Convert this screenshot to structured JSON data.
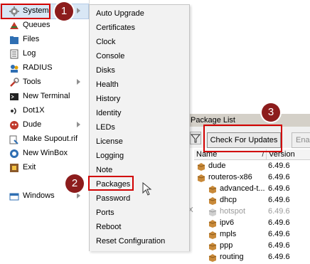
{
  "main_menu": {
    "items": [
      {
        "label": "System",
        "icon": "gear-icon",
        "has_submenu": true
      },
      {
        "label": "Queues",
        "icon": "queues-icon",
        "has_submenu": false
      },
      {
        "label": "Files",
        "icon": "folder-icon",
        "has_submenu": false
      },
      {
        "label": "Log",
        "icon": "log-icon",
        "has_submenu": false
      },
      {
        "label": "RADIUS",
        "icon": "radius-icon",
        "has_submenu": false
      },
      {
        "label": "Tools",
        "icon": "tools-icon",
        "has_submenu": true
      },
      {
        "label": "New Terminal",
        "icon": "terminal-icon",
        "has_submenu": false
      },
      {
        "label": "Dot1X",
        "icon": "dot1x-icon",
        "has_submenu": false
      },
      {
        "label": "Dude",
        "icon": "dude-icon",
        "has_submenu": true
      },
      {
        "label": "Make Supout.rif",
        "icon": "supout-icon",
        "has_submenu": false
      },
      {
        "label": "New WinBox",
        "icon": "winbox-icon",
        "has_submenu": false
      },
      {
        "label": "Exit",
        "icon": "exit-icon",
        "has_submenu": false
      },
      {
        "label": "Windows",
        "icon": "windows-icon",
        "has_submenu": true
      }
    ]
  },
  "submenu": {
    "items": [
      "Auto Upgrade",
      "Certificates",
      "Clock",
      "Console",
      "Disks",
      "Health",
      "History",
      "Identity",
      "LEDs",
      "License",
      "Logging",
      "Note",
      "Packages",
      "Password",
      "Ports",
      "Reboot",
      "Reset Configuration"
    ]
  },
  "steps": [
    "1",
    "2",
    "3"
  ],
  "package_window": {
    "title": "Package List",
    "toolbar": {
      "check_updates": "Check For Updates",
      "enable": "Enable"
    },
    "columns": {
      "name": "Name",
      "version": "Version"
    },
    "rows": [
      {
        "name": "dude",
        "version": "6.49.6",
        "indent": 0,
        "disabled": false
      },
      {
        "name": "routeros-x86",
        "version": "6.49.6",
        "indent": 0,
        "disabled": false
      },
      {
        "name": "advanced-t...",
        "version": "6.49.6",
        "indent": 1,
        "disabled": false
      },
      {
        "name": "dhcp",
        "version": "6.49.6",
        "indent": 1,
        "disabled": false
      },
      {
        "name": "hotspot",
        "version": "6.49.6",
        "indent": 1,
        "disabled": true
      },
      {
        "name": "ipv6",
        "version": "6.49.6",
        "indent": 1,
        "disabled": false
      },
      {
        "name": "mpls",
        "version": "6.49.6",
        "indent": 1,
        "disabled": false
      },
      {
        "name": "ppp",
        "version": "6.49.6",
        "indent": 1,
        "disabled": false
      },
      {
        "name": "routing",
        "version": "6.49.6",
        "indent": 1,
        "disabled": false
      }
    ]
  },
  "colors": {
    "highlight_red": "#d10000",
    "badge": "#8c1c1c",
    "menu_hover": "#d9e7f5"
  }
}
